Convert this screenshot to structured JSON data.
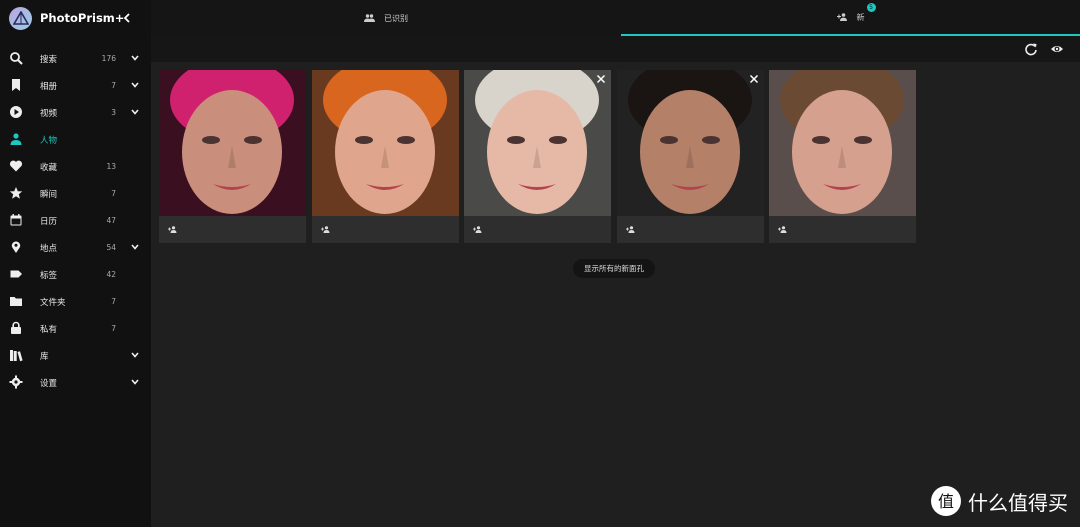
{
  "app": {
    "title": "PhotoPrism+"
  },
  "sidebar": {
    "items": [
      {
        "label": "搜索",
        "count": "176",
        "icon": "search-icon",
        "chevron": true,
        "active": false
      },
      {
        "label": "相册",
        "count": "7",
        "icon": "bookmark-icon",
        "chevron": true,
        "active": false
      },
      {
        "label": "视频",
        "count": "3",
        "icon": "play-circle-icon",
        "chevron": true,
        "active": false
      },
      {
        "label": "人物",
        "count": "",
        "icon": "person-icon",
        "chevron": false,
        "active": true
      },
      {
        "label": "收藏",
        "count": "13",
        "icon": "heart-icon",
        "chevron": false,
        "active": false
      },
      {
        "label": "瞬间",
        "count": "7",
        "icon": "star-icon",
        "chevron": false,
        "active": false
      },
      {
        "label": "日历",
        "count": "47",
        "icon": "calendar-icon",
        "chevron": false,
        "active": false
      },
      {
        "label": "地点",
        "count": "54",
        "icon": "location-pin-icon",
        "chevron": true,
        "active": false
      },
      {
        "label": "标签",
        "count": "42",
        "icon": "label-icon",
        "chevron": false,
        "active": false
      },
      {
        "label": "文件夹",
        "count": "7",
        "icon": "folder-icon",
        "chevron": false,
        "active": false
      },
      {
        "label": "私有",
        "count": "7",
        "icon": "lock-icon",
        "chevron": false,
        "active": false
      },
      {
        "label": "库",
        "count": "",
        "icon": "library-icon",
        "chevron": true,
        "active": false
      },
      {
        "label": "设置",
        "count": "",
        "icon": "gear-icon",
        "chevron": true,
        "active": false
      }
    ]
  },
  "tabs": {
    "recognized": {
      "label": "已识别"
    },
    "new": {
      "label": "新",
      "badge": "5"
    }
  },
  "faces": [
    {
      "dismissable": false,
      "skin": "#c98f7c",
      "hair": "#d0216f",
      "bg": "#3a1020"
    },
    {
      "dismissable": false,
      "skin": "#e0a68d",
      "hair": "#d9661f",
      "bg": "#6a3a20"
    },
    {
      "dismissable": true,
      "skin": "#e5b9a6",
      "hair": "#d8d4cc",
      "bg": "#4a4a48"
    },
    {
      "dismissable": true,
      "skin": "#b48068",
      "hair": "#1a1412",
      "bg": "#222"
    },
    {
      "dismissable": false,
      "skin": "#d6a08e",
      "hair": "#6a4a32",
      "bg": "#5a4e4c"
    }
  ],
  "actions": {
    "show_all": "显示所有的新面孔"
  },
  "accent": "#1ec7c0",
  "watermark": {
    "logo_char": "值",
    "text": "什么值得买"
  }
}
